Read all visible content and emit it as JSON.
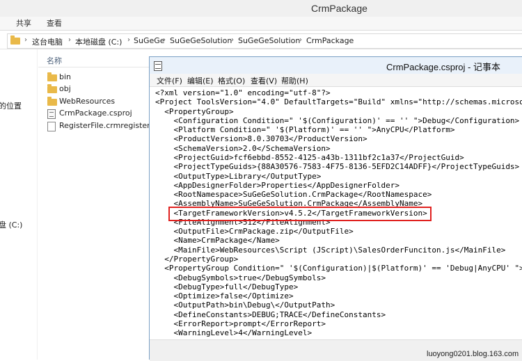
{
  "explorer": {
    "title": "CrmPackage",
    "ribbon_tabs": [
      "共享",
      "查看"
    ],
    "breadcrumb": [
      "这台电脑",
      "本地磁盘 (C:)",
      "SuGeGe",
      "SuGeGeSolution",
      "SuGeGeSolution",
      "CrmPackage"
    ],
    "column_header": "名称",
    "nav_items": [
      "的位置",
      "盘 (C:)"
    ],
    "files": [
      {
        "name": "bin",
        "icon": "folder-icon"
      },
      {
        "name": "obj",
        "icon": "folder-icon"
      },
      {
        "name": "WebResources",
        "icon": "folder-icon"
      },
      {
        "name": "CrmPackage.csproj",
        "icon": "csproj-file-icon"
      },
      {
        "name": "RegisterFile.crmregister",
        "icon": "document-icon"
      }
    ]
  },
  "notepad": {
    "title": "CrmPackage.csproj - 记事本",
    "menu": [
      "文件(F)",
      "编辑(E)",
      "格式(O)",
      "查看(V)",
      "帮助(H)"
    ],
    "lines": [
      "<?xml version=\"1.0\" encoding=\"utf-8\"?>",
      "<Project ToolsVersion=\"4.0\" DefaultTargets=\"Build\" xmlns=\"http://schemas.microsoft",
      "  <PropertyGroup>",
      "    <Configuration Condition=\" '$(Configuration)' == '' \">Debug</Configuration>",
      "    <Platform Condition=\" '$(Platform)' == '' \">AnyCPU</Platform>",
      "    <ProductVersion>8.0.30703</ProductVersion>",
      "    <SchemaVersion>2.0</SchemaVersion>",
      "    <ProjectGuid>fcf6ebbd-8552-4125-a43b-1311bf2c1a37</ProjectGuid>",
      "    <ProjectTypeGuids>{88A30576-7583-4F75-8136-5EFD2C14ADFF}</ProjectTypeGuids>",
      "    <OutputType>Library</OutputType>",
      "    <AppDesignerFolder>Properties</AppDesignerFolder>",
      "    <RootNamespace>SuGeGeSolution.CrmPackage</RootNamespace>",
      "    <AssemblyName>SuGeGeSolution.CrmPackage</AssemblyName>",
      "    <TargetFrameworkVersion>v4.5.2</TargetFrameworkVersion>",
      "    <FileAlignment>512</FileAlignment>",
      "    <OutputFile>CrmPackage.zip</OutputFile>",
      "    <Name>CrmPackage</Name>",
      "    <MainFile>WebResources\\Script (JScript)\\SalesOrderFunciton.js</MainFile>",
      "  </PropertyGroup>",
      "  <PropertyGroup Condition=\" '$(Configuration)|$(Platform)' == 'Debug|AnyCPU' \">",
      "    <DebugSymbols>true</DebugSymbols>",
      "    <DebugType>full</DebugType>",
      "    <Optimize>false</Optimize>",
      "    <OutputPath>bin\\Debug\\</OutputPath>",
      "    <DefineConstants>DEBUG;TRACE</DefineConstants>",
      "    <ErrorReport>prompt</ErrorReport>",
      "    <WarningLevel>4</WarningLevel>"
    ],
    "highlight_color": "#e0201e"
  },
  "watermark": "luoyong0201.blog.163.com"
}
